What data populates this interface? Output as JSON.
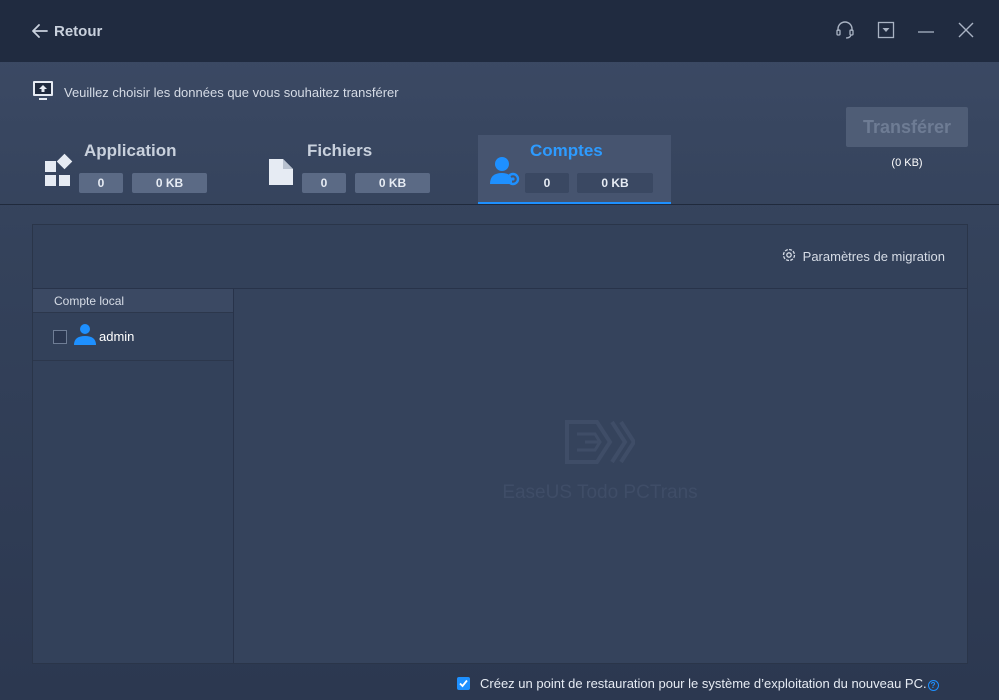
{
  "titlebar": {
    "back_label": "Retour",
    "icons": [
      "support-icon",
      "dropdown-menu-icon",
      "minimize-icon",
      "close-icon"
    ]
  },
  "prompt": {
    "text": "Veuillez choisir les données que vous souhaitez transférer",
    "icon": "monitor-upload-icon"
  },
  "tabs": [
    {
      "label": "Application",
      "count": "0",
      "size": "0 KB",
      "icon": "apps-grid-icon",
      "active": false
    },
    {
      "label": "Fichiers",
      "count": "0",
      "size": "0 KB",
      "icon": "file-icon",
      "active": false
    },
    {
      "label": "Comptes",
      "count": "0",
      "size": "0 KB",
      "icon": "user-settings-icon",
      "active": true
    }
  ],
  "transfer": {
    "label": "Transférer",
    "size": "(0 KB)"
  },
  "panel": {
    "migration_settings": "Paramètres de migration",
    "left_header": "Compte local",
    "accounts": [
      {
        "name": "admin",
        "checked": false
      }
    ],
    "watermark": "EaseUS Todo PCTrans"
  },
  "restore": {
    "label": "Créez un point de restauration pour le système d’exploitation du nouveau PC.",
    "checked": true,
    "help": "?"
  },
  "colors": {
    "accent": "#1e90ff",
    "titlebar": "#202b40",
    "background": "#34425b"
  }
}
